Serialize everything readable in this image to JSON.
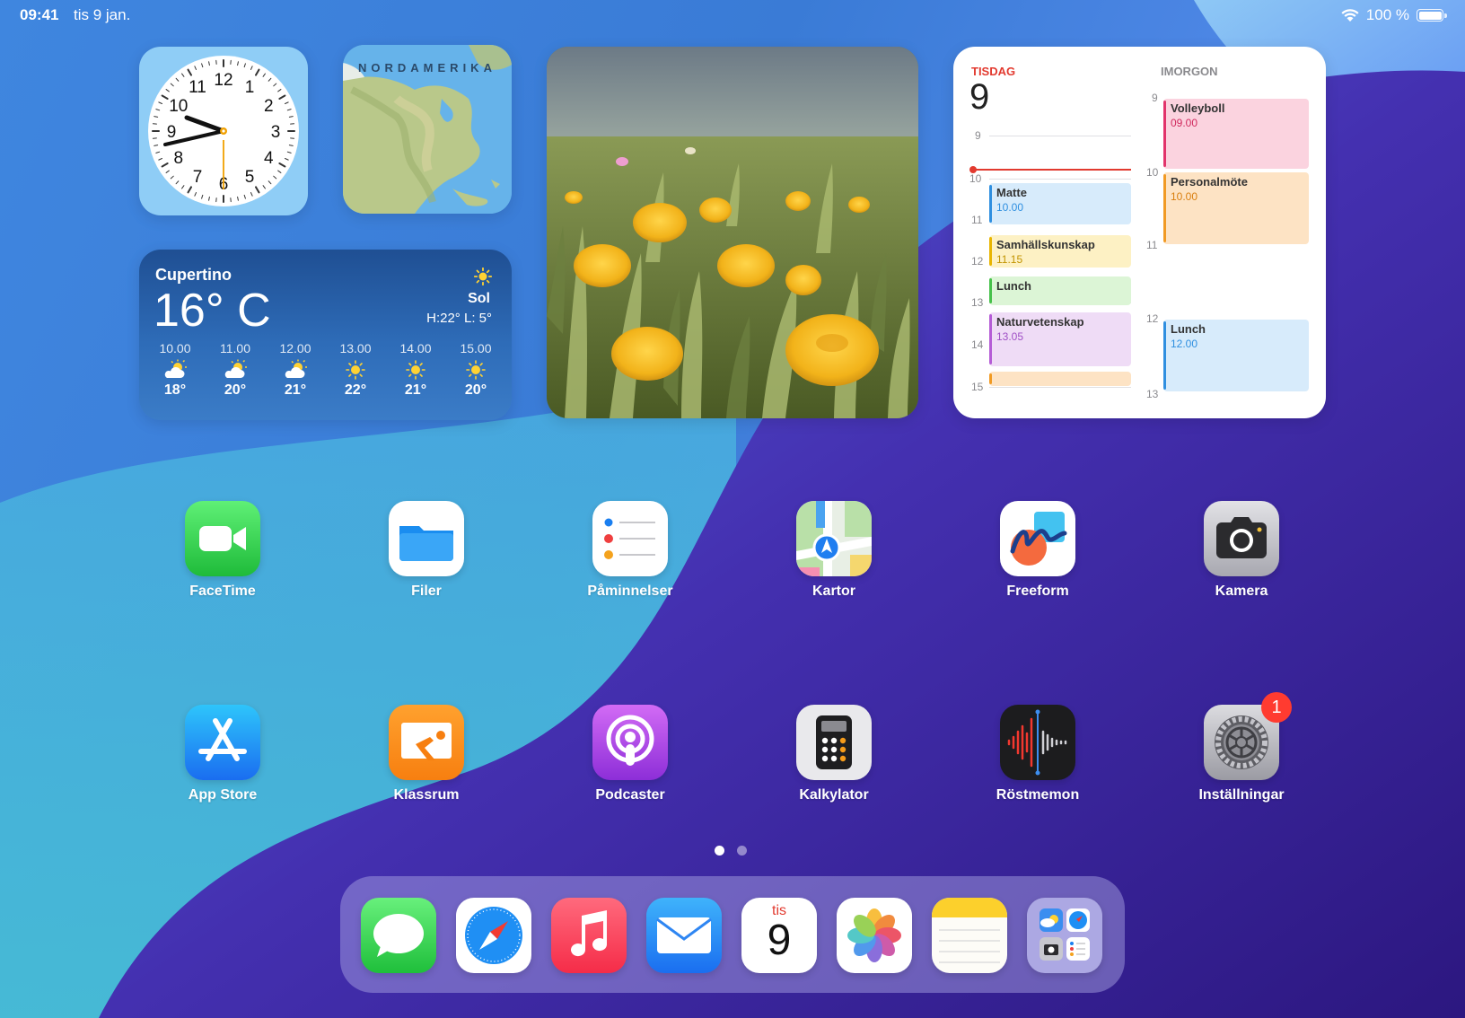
{
  "status_bar": {
    "time": "09:41",
    "date": "tis 9 jan.",
    "battery": "100 %"
  },
  "map_widget": {
    "title": "NORDAMERIKA"
  },
  "weather": {
    "city": "Cupertino",
    "temp": "16° C",
    "condition": "Sol",
    "hilo": "H:22°  L:  5°",
    "hours": [
      {
        "time": "10.00",
        "icon": "partly-sunny-icon",
        "temp": "18°"
      },
      {
        "time": "11.00",
        "icon": "partly-sunny-icon",
        "temp": "20°"
      },
      {
        "time": "12.00",
        "icon": "partly-sunny-icon",
        "temp": "21°"
      },
      {
        "time": "13.00",
        "icon": "sun-icon",
        "temp": "22°"
      },
      {
        "time": "14.00",
        "icon": "sun-icon",
        "temp": "21°"
      },
      {
        "time": "15.00",
        "icon": "sun-icon",
        "temp": "20°"
      }
    ]
  },
  "calendar": {
    "today_label": "TISDAG",
    "today_num": "9",
    "tomorrow_label": "IMORGON",
    "today_hours": [
      "9",
      "10",
      "11",
      "12",
      "13",
      "14",
      "15"
    ],
    "tomorrow_hours": [
      "9",
      "10",
      "11",
      "12",
      "13"
    ],
    "today_events": [
      {
        "title": "Matte",
        "time": "10.00",
        "color": "blue"
      },
      {
        "title": "Samhällskunskap",
        "time": "11.15",
        "color": "yellow"
      },
      {
        "title": "Lunch",
        "time": "",
        "color": "green"
      },
      {
        "title": "Naturvetenskap",
        "time": "13.05",
        "color": "purple"
      },
      {
        "title": "",
        "time": "",
        "color": "orange"
      }
    ],
    "tomorrow_events": [
      {
        "title": "Volleyboll",
        "time": "09.00",
        "color": "pink"
      },
      {
        "title": "Personalmöte",
        "time": "10.00",
        "color": "orange"
      },
      {
        "title": "Lunch",
        "time": "12.00",
        "color": "blue"
      }
    ]
  },
  "apps": [
    {
      "label": "FaceTime",
      "icon": "facetime-icon"
    },
    {
      "label": "Filer",
      "icon": "files-icon"
    },
    {
      "label": "Påminnelser",
      "icon": "reminders-icon"
    },
    {
      "label": "Kartor",
      "icon": "maps-icon"
    },
    {
      "label": "Freeform",
      "icon": "freeform-icon"
    },
    {
      "label": "Kamera",
      "icon": "camera-icon"
    },
    {
      "label": "App Store",
      "icon": "app-store-icon"
    },
    {
      "label": "Klassrum",
      "icon": "classroom-icon"
    },
    {
      "label": "Podcaster",
      "icon": "podcasts-icon"
    },
    {
      "label": "Kalkylator",
      "icon": "calculator-icon"
    },
    {
      "label": "Röstmemon",
      "icon": "voice-memos-icon"
    },
    {
      "label": "Inställningar",
      "icon": "settings-icon",
      "badge": "1"
    }
  ],
  "page_dots": {
    "count": 2,
    "active": 0
  },
  "dock": {
    "apps": [
      "messages-icon",
      "safari-icon",
      "music-icon",
      "mail-icon",
      "calendar-icon",
      "photos-icon",
      "notes-icon",
      "app-library-icon"
    ],
    "calendar_day": "tis",
    "calendar_num": "9"
  },
  "colors": {
    "accent_red": "#e23a2f",
    "wallpaper_blue": "#3a7fd8",
    "wallpaper_purple": "#4a2ea8"
  }
}
